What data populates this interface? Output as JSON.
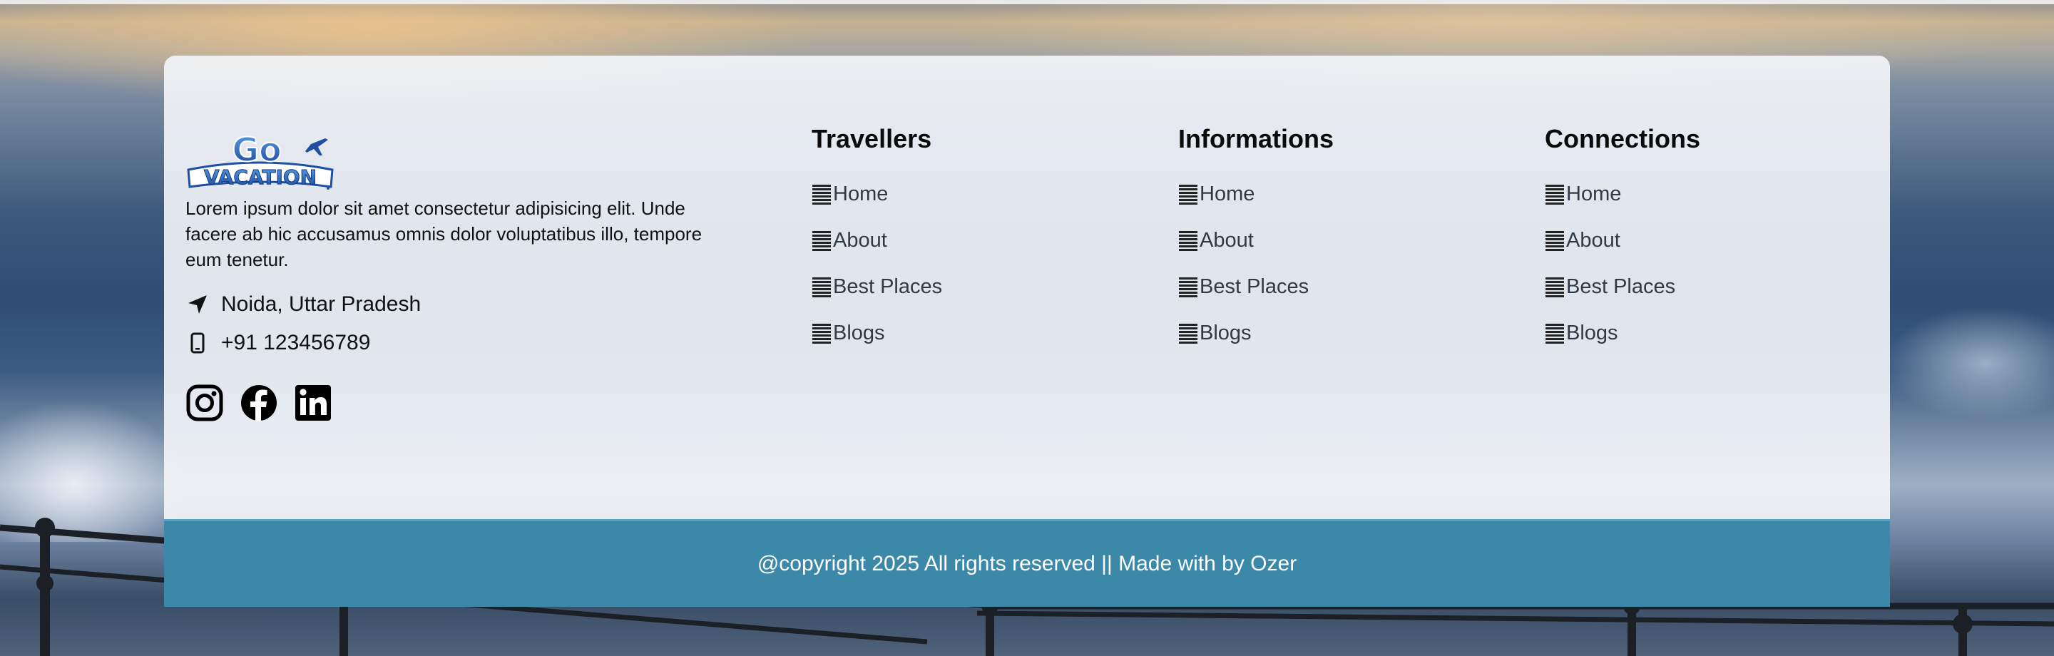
{
  "brand": {
    "logo_top": "Go",
    "logo_bottom": "VACATION",
    "description": "Lorem ipsum dolor sit amet consectetur adipisicing elit. Unde facere ab hic accusamus omnis dolor voluptatibus illo, tempore eum tenetur.",
    "location": "Noida, Uttar Pradesh",
    "phone": "+91 123456789",
    "socials": [
      "instagram-icon",
      "facebook-icon",
      "linkedin-icon"
    ]
  },
  "columns": [
    {
      "title": "Travellers",
      "links": [
        "Home",
        "About",
        "Best Places",
        "Blogs"
      ]
    },
    {
      "title": "Informations",
      "links": [
        "Home",
        "About",
        "Best Places",
        "Blogs"
      ]
    },
    {
      "title": "Connections",
      "links": [
        "Home",
        "About",
        "Best Places",
        "Blogs"
      ]
    }
  ],
  "footer": {
    "copyright": "@copyright 2025 All rights reserved || Made with by Ozer"
  },
  "colors": {
    "bar": "#3b88a8",
    "logo_blue": "#1f4fa3"
  }
}
